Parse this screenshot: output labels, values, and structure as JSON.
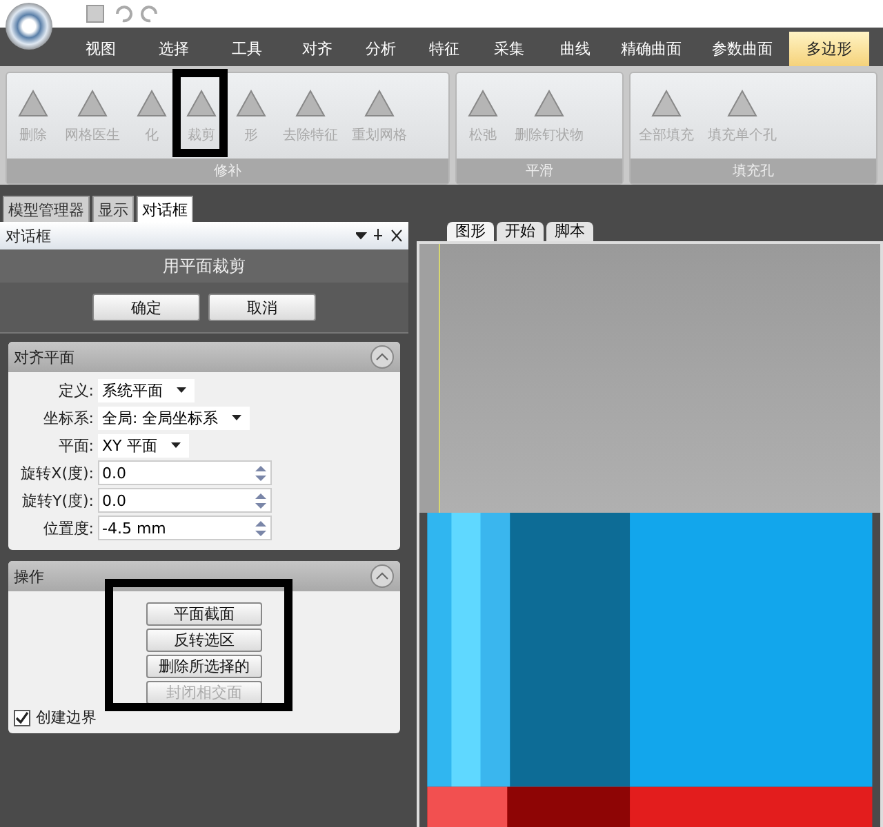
{
  "menu_tabs": [
    {
      "label": "视图",
      "selected": false
    },
    {
      "label": "选择",
      "selected": false
    },
    {
      "label": "工具",
      "selected": false
    },
    {
      "label": "对齐",
      "selected": false
    },
    {
      "label": "分析",
      "selected": false
    },
    {
      "label": "特征",
      "selected": false
    },
    {
      "label": "采集",
      "selected": false
    },
    {
      "label": "曲线",
      "selected": false
    },
    {
      "label": "精确曲面",
      "selected": false
    },
    {
      "label": "参数曲面",
      "selected": false
    },
    {
      "label": "多边形",
      "selected": true
    }
  ],
  "ribbon_groups": [
    {
      "label": "修补",
      "buttons": [
        {
          "label": "删除"
        },
        {
          "label": "网格医生"
        },
        {
          "label": "化"
        },
        {
          "label": "裁剪"
        },
        {
          "label": "形"
        },
        {
          "label": "去除特征"
        },
        {
          "label": "重划网格"
        }
      ]
    },
    {
      "label": "平滑",
      "buttons": [
        {
          "label": "松弛"
        },
        {
          "label": "删除钉状物"
        }
      ]
    },
    {
      "label": "填充孔",
      "buttons": [
        {
          "label": "全部填充"
        },
        {
          "label": "填充单个孔"
        }
      ]
    }
  ],
  "panel_tabs": [
    {
      "label": "模型管理器",
      "selected": false
    },
    {
      "label": "显示",
      "selected": false
    },
    {
      "label": "对话框",
      "selected": true
    }
  ],
  "view_tabs": [
    {
      "label": "图形",
      "selected": true
    },
    {
      "label": "开始",
      "selected": false
    },
    {
      "label": "脚本",
      "selected": false
    }
  ],
  "dialog": {
    "title": "对话框",
    "heading": "用平面裁剪",
    "buttons": [
      "确定",
      "取消"
    ],
    "align_section": {
      "title": "对齐平面",
      "fields": [
        {
          "kind": "select",
          "label": "定义:",
          "value": "系统平面"
        },
        {
          "kind": "select",
          "label": "坐标系:",
          "value": "全局: 全局坐标系"
        },
        {
          "kind": "select",
          "label": "平面:",
          "value": "XY 平面"
        },
        {
          "kind": "spin",
          "label": "旋转X(度):",
          "value": "0.0"
        },
        {
          "kind": "spin",
          "label": "旋转Y(度):",
          "value": "0.0"
        },
        {
          "kind": "spin",
          "label": "位置度:",
          "value": "-4.5 mm"
        }
      ]
    },
    "operation_section": {
      "title": "操作",
      "buttons": [
        {
          "label": "平面截面",
          "disabled": false
        },
        {
          "label": "反转选区",
          "disabled": false
        },
        {
          "label": "删除所选择的",
          "disabled": false
        },
        {
          "label": "封闭相交面",
          "disabled": true
        }
      ],
      "checkbox": {
        "label": "创建边界",
        "checked": true
      }
    }
  }
}
